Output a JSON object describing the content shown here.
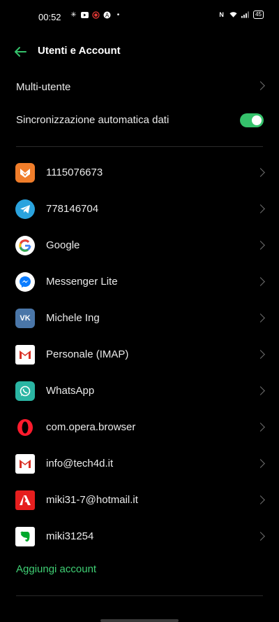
{
  "status": {
    "time": "00:52",
    "battery": "45"
  },
  "header": {
    "title": "Utenti e Account"
  },
  "settings": {
    "multi_user": "Multi-utente",
    "auto_sync": "Sincronizzazione automatica dati",
    "auto_sync_on": true
  },
  "accounts": [
    {
      "label": "1115076673",
      "icon": "orange-fox-icon"
    },
    {
      "label": "778146704",
      "icon": "telegram-icon"
    },
    {
      "label": "Google",
      "icon": "google-icon"
    },
    {
      "label": "Messenger Lite",
      "icon": "messenger-icon"
    },
    {
      "label": "Michele Ing",
      "icon": "vk-icon"
    },
    {
      "label": "Personale (IMAP)",
      "icon": "gmail-icon"
    },
    {
      "label": "WhatsApp",
      "icon": "whatsapp-icon"
    },
    {
      "label": "com.opera.browser",
      "icon": "opera-icon"
    },
    {
      "label": "info@tech4d.it",
      "icon": "gmail-icon"
    },
    {
      "label": "miki31-7@hotmail.it",
      "icon": "adobe-icon"
    },
    {
      "label": "miki31254",
      "icon": "evernote-icon"
    }
  ],
  "add_account": "Aggiungi account",
  "colors": {
    "accent": "#35c26b",
    "link": "#3fcf74",
    "background": "#000000"
  }
}
